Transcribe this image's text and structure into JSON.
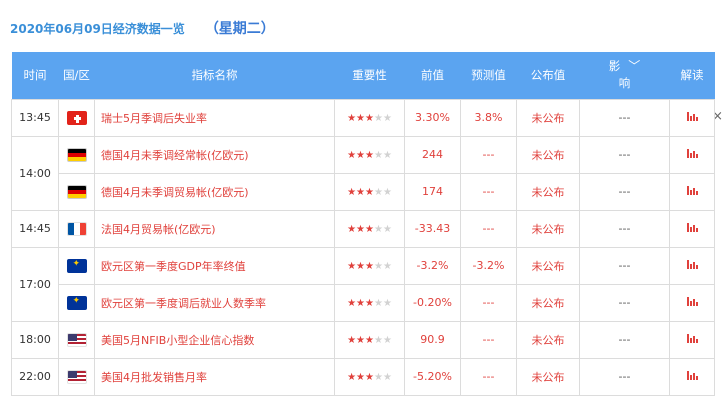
{
  "header": {
    "date": "2020年06月09日经济数据一览",
    "weekday": "（星期二）"
  },
  "columns": {
    "time": "时间",
    "region": "国/区",
    "indicator": "指标名称",
    "importance": "重要性",
    "previous": "前值",
    "forecast": "预测值",
    "actual": "公布值",
    "impact_top": "影",
    "impact_bottom": "响",
    "analysis": "解读"
  },
  "close_glyph": "×",
  "rows": [
    {
      "time": "13:45",
      "flag": "switzerland-flag",
      "indicator": "瑞士5月季调后失业率",
      "stars": 3,
      "previous": "3.30%",
      "forecast": "3.8%",
      "actual": "未公布",
      "impact": "---"
    },
    {
      "time": "14:00",
      "flag": "germany-flag",
      "indicator": "德国4月未季调经常帐(亿欧元)",
      "stars": 3,
      "previous": "244",
      "forecast": "---",
      "actual": "未公布",
      "impact": "---"
    },
    {
      "time": "",
      "flag": "germany-flag",
      "indicator": "德国4月未季调贸易帐(亿欧元)",
      "stars": 3,
      "previous": "174",
      "forecast": "---",
      "actual": "未公布",
      "impact": "---"
    },
    {
      "time": "14:45",
      "flag": "france-flag",
      "indicator": "法国4月贸易帐(亿欧元)",
      "stars": 3,
      "previous": "-33.43",
      "forecast": "---",
      "actual": "未公布",
      "impact": "---"
    },
    {
      "time": "17:00",
      "flag": "eu-flag",
      "indicator": "欧元区第一季度GDP年率终值",
      "stars": 3,
      "previous": "-3.2%",
      "forecast": "-3.2%",
      "actual": "未公布",
      "impact": "---"
    },
    {
      "time": "",
      "flag": "eu-flag",
      "indicator": "欧元区第一季度调后就业人数季率",
      "stars": 3,
      "previous": "-0.20%",
      "forecast": "---",
      "actual": "未公布",
      "impact": "---"
    },
    {
      "time": "18:00",
      "flag": "usa-flag",
      "indicator": "美国5月NFIB小型企业信心指数",
      "stars": 3,
      "previous": "90.9",
      "forecast": "---",
      "actual": "未公布",
      "impact": "---"
    },
    {
      "time": "22:00",
      "flag": "usa-flag",
      "indicator": "美国4月批发销售月率",
      "stars": 3,
      "previous": "-5.20%",
      "forecast": "---",
      "actual": "未公布",
      "impact": "---"
    }
  ]
}
